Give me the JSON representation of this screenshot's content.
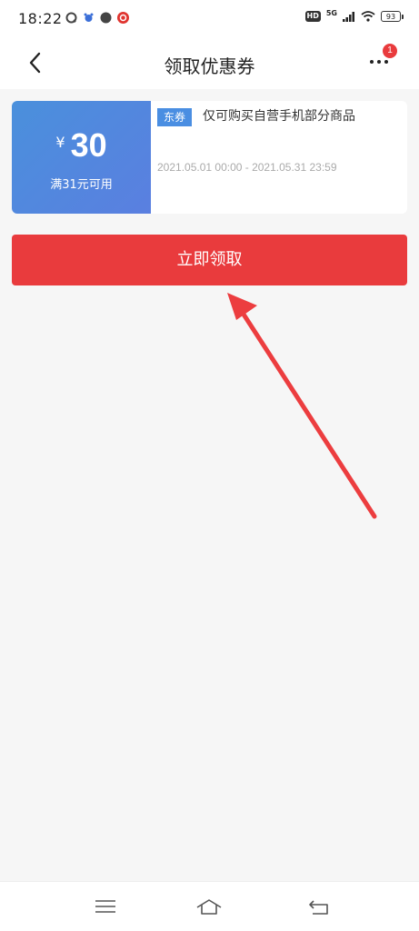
{
  "status_bar": {
    "time": "18:22",
    "network": "5G",
    "hd": "HD",
    "battery": "93",
    "icons": [
      "qq-icon",
      "baidu-icon",
      "compass-icon",
      "app-red-icon",
      "signal-icon",
      "wifi-icon"
    ]
  },
  "navbar": {
    "title": "领取优惠券",
    "notification_count": "1"
  },
  "coupon": {
    "currency": "¥",
    "amount": "30",
    "condition": "满31元可用",
    "tag": "东券",
    "description": "仅可购买自营手机部分商品",
    "validity": "2021.05.01 00:00 - 2021.05.31 23:59",
    "left_color": "#4a90dc"
  },
  "claim_button": {
    "label": "立即领取",
    "color": "#e93b3d"
  },
  "annotation": {
    "arrow_color": "#ec3d3f"
  },
  "system_nav": {
    "icons": [
      "menu-icon",
      "home-icon",
      "back-icon"
    ]
  }
}
